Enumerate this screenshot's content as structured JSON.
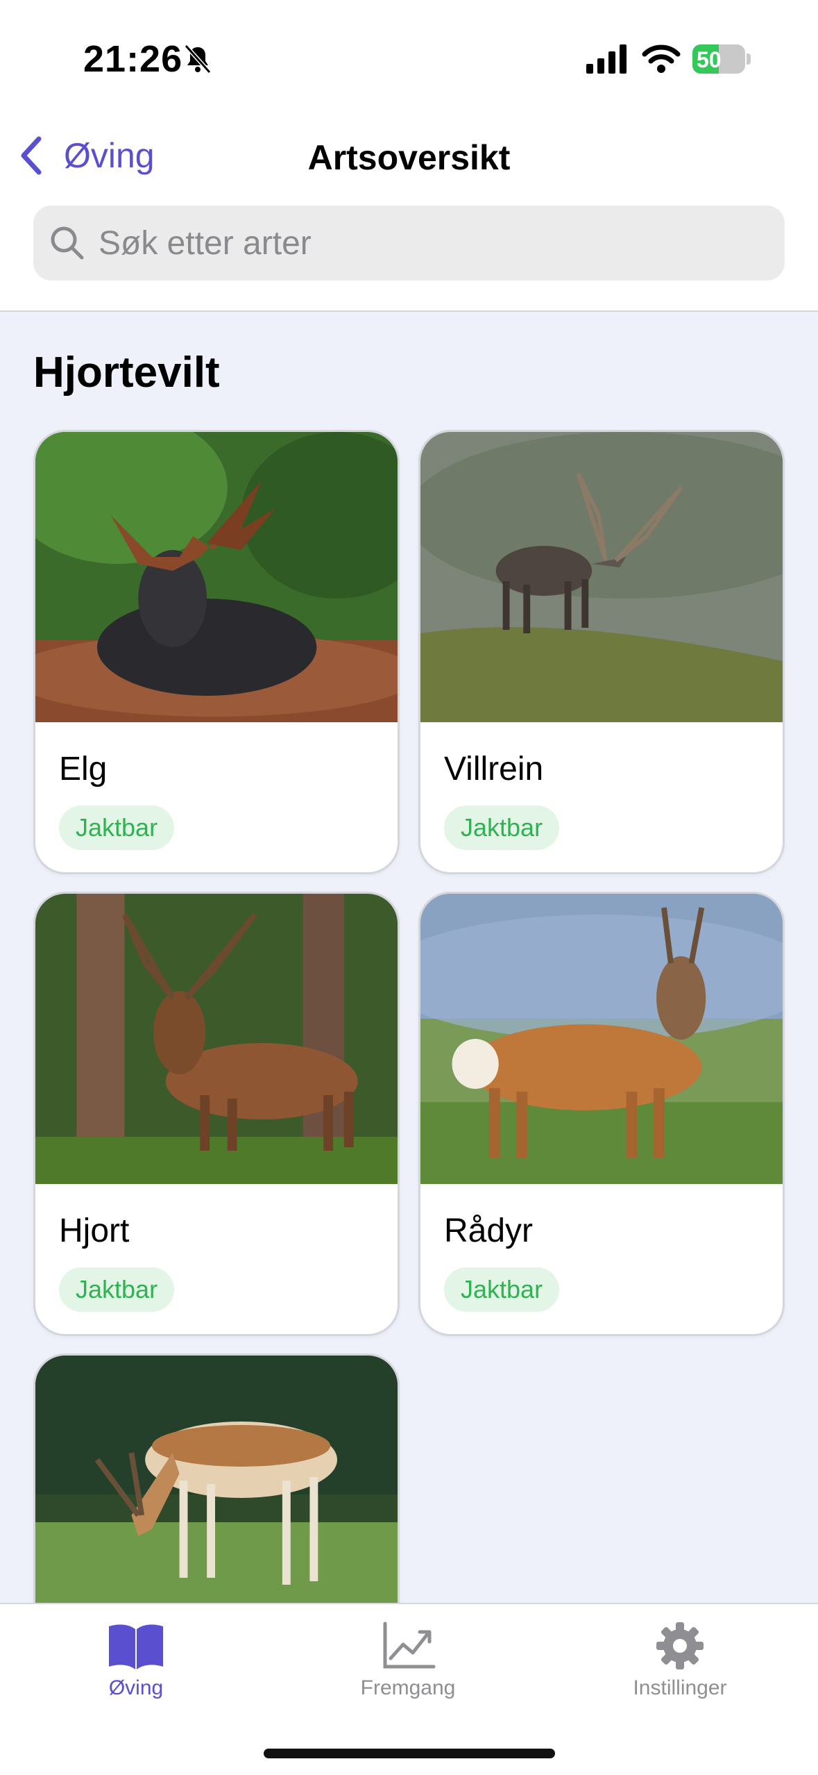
{
  "status": {
    "time": "21:26",
    "battery": "50",
    "battery_level": 0.5
  },
  "nav": {
    "back_label": "Øving",
    "title": "Artsoversikt"
  },
  "search": {
    "placeholder": "Søk etter arter"
  },
  "section": {
    "title": "Hjortevilt"
  },
  "species": [
    {
      "name": "Elg",
      "badge": "Jaktbar"
    },
    {
      "name": "Villrein",
      "badge": "Jaktbar"
    },
    {
      "name": "Hjort",
      "badge": "Jaktbar"
    },
    {
      "name": "Rådyr",
      "badge": "Jaktbar"
    }
  ],
  "tabs": [
    {
      "label": "Øving",
      "icon": "book-icon",
      "active": true
    },
    {
      "label": "Fremgang",
      "icon": "chart-icon",
      "active": false
    },
    {
      "label": "Instillinger",
      "icon": "gear-icon",
      "active": false
    }
  ],
  "colors": {
    "accent": "#5a4fcf",
    "badge_text": "#2fb350",
    "badge_bg": "#e3f5e7",
    "inactive": "#8e8e93"
  }
}
